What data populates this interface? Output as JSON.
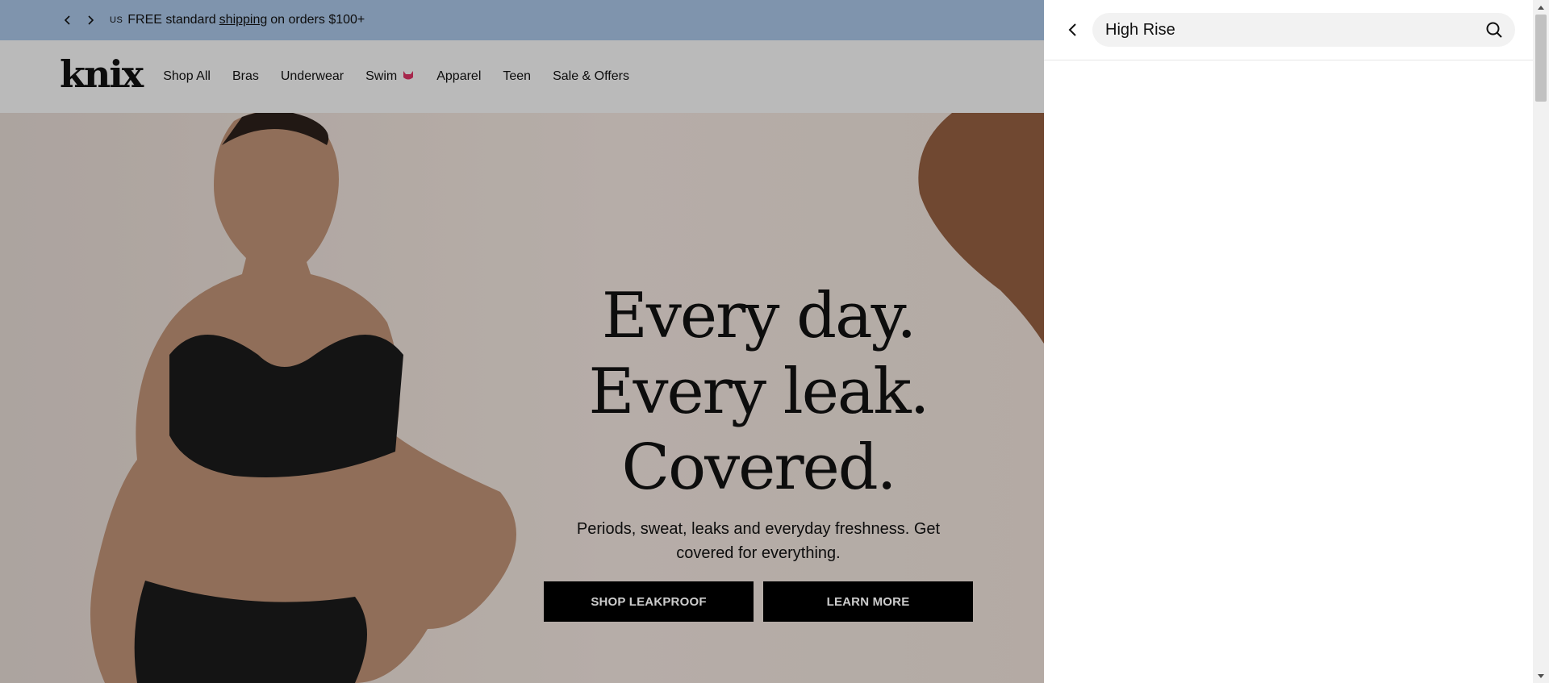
{
  "announcement": {
    "prev_icon": "chevron-left-icon",
    "next_icon": "chevron-right-icon",
    "country": "US",
    "text_before": "FREE standard",
    "link": "shipping",
    "text_after": "on orders $100+"
  },
  "header": {
    "logo": "knix",
    "nav": [
      "Shop All",
      "Bras",
      "Underwear",
      "Swim",
      "Apparel",
      "Teen",
      "Sale & Offers"
    ],
    "swim_icon": "cat-icon"
  },
  "hero": {
    "headline_1": "Every day.",
    "headline_2": "Every leak.",
    "headline_3": "Covered.",
    "subtitle": "Periods, sweat, leaks and everyday freshness. Get covered for everything.",
    "cta_primary": "SHOP LEAKPROOF",
    "cta_secondary": "LEARN MORE"
  },
  "search": {
    "value": "High Rise",
    "back_icon": "chevron-left-icon",
    "submit_icon": "search-icon"
  },
  "colors": {
    "announcement_bg": "#9fb9d9",
    "nav_bg": "#e9e9e9",
    "cta_bg": "#000000",
    "drawer_bg": "#ffffff"
  }
}
